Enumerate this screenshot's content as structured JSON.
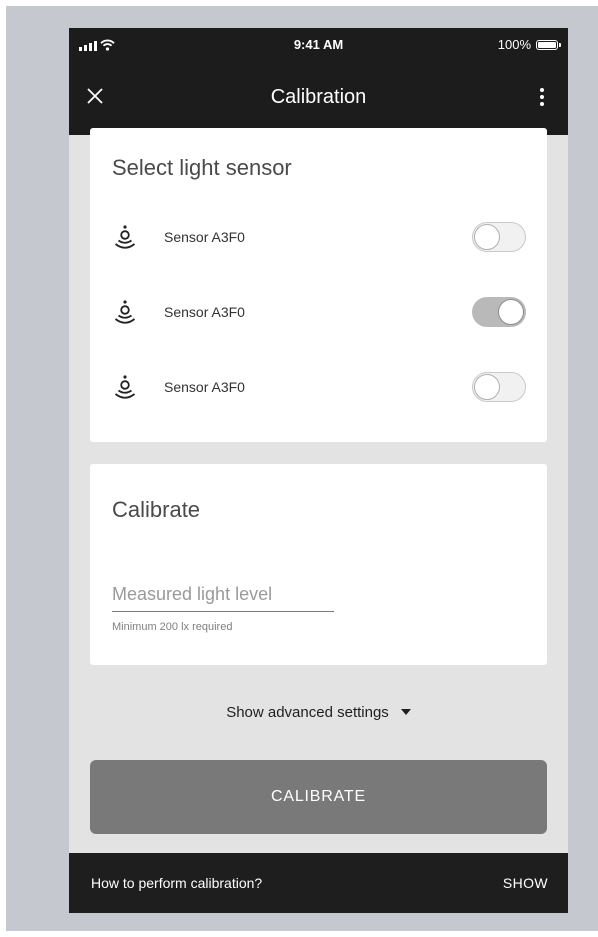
{
  "status_bar": {
    "time": "9:41 AM",
    "battery": "100%"
  },
  "app_bar": {
    "title": "Calibration",
    "close_icon": "close-icon",
    "more_icon": "more-vertical-icon"
  },
  "sensor_card": {
    "title": "Select light sensor",
    "sensors": [
      {
        "label": "Sensor A3F0",
        "enabled": false,
        "icon": "light-sensor-icon"
      },
      {
        "label": "Sensor A3F0",
        "enabled": true,
        "icon": "light-sensor-icon"
      },
      {
        "label": "Sensor A3F0",
        "enabled": false,
        "icon": "light-sensor-icon"
      }
    ]
  },
  "calibrate_card": {
    "title": "Calibrate",
    "field_placeholder": "Measured light level",
    "field_value": "",
    "helper": "Minimum 200 lx required"
  },
  "advanced": {
    "label": "Show advanced settings",
    "icon": "caret-down-icon"
  },
  "primary_button": {
    "label": "CALIBRATE"
  },
  "snackbar": {
    "text": "How to perform calibration?",
    "action": "SHOW"
  },
  "colors": {
    "app_bar": "#1c1c1c",
    "background": "#e3e3e3",
    "button": "#797979",
    "toggle_on": "#b9b9b9"
  }
}
